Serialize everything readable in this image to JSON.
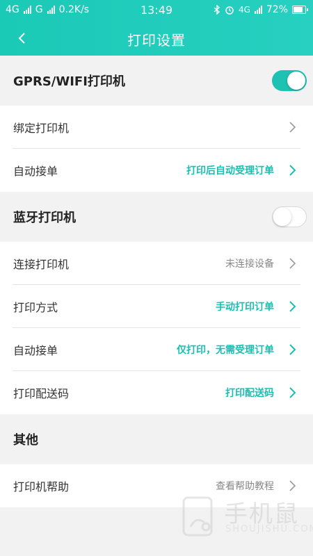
{
  "status_bar": {
    "carrier1": "4G",
    "carrier2": "G",
    "speed": "0.2K/s",
    "time": "13:49",
    "network_right": "4G",
    "battery": "72%"
  },
  "header": {
    "title": "打印设置"
  },
  "sections": {
    "gprs": {
      "title": "GPRS/WIFI打印机",
      "toggle_on": true,
      "rows": [
        {
          "label": "绑定打印机",
          "value": ""
        },
        {
          "label": "自动接单",
          "value": "打印后自动受理订单"
        }
      ]
    },
    "bluetooth": {
      "title": "蓝牙打印机",
      "toggle_on": false,
      "rows": [
        {
          "label": "连接打印机",
          "value": "未连接设备"
        },
        {
          "label": "打印方式",
          "value": "手动打印订单"
        },
        {
          "label": "自动接单",
          "value": "仅打印，无需受理订单"
        },
        {
          "label": "打印配送码",
          "value": "打印配送码"
        }
      ]
    },
    "other": {
      "title": "其他",
      "rows": [
        {
          "label": "打印机帮助",
          "value": "查看帮助教程"
        }
      ]
    }
  },
  "watermark": {
    "cn": "手机鼠",
    "en": "SHOUJISHU.COM"
  },
  "colors": {
    "accent": "#1dc2b3",
    "header_bg": "#22ccbb",
    "value_teal": "#19bfb0",
    "value_gray": "#888888",
    "background": "#f2f2f2"
  },
  "icons": {
    "back": "back-arrow-icon",
    "chevron": "chevron-right-icon",
    "bluetooth": "bluetooth-icon",
    "alarm": "alarm-icon"
  }
}
